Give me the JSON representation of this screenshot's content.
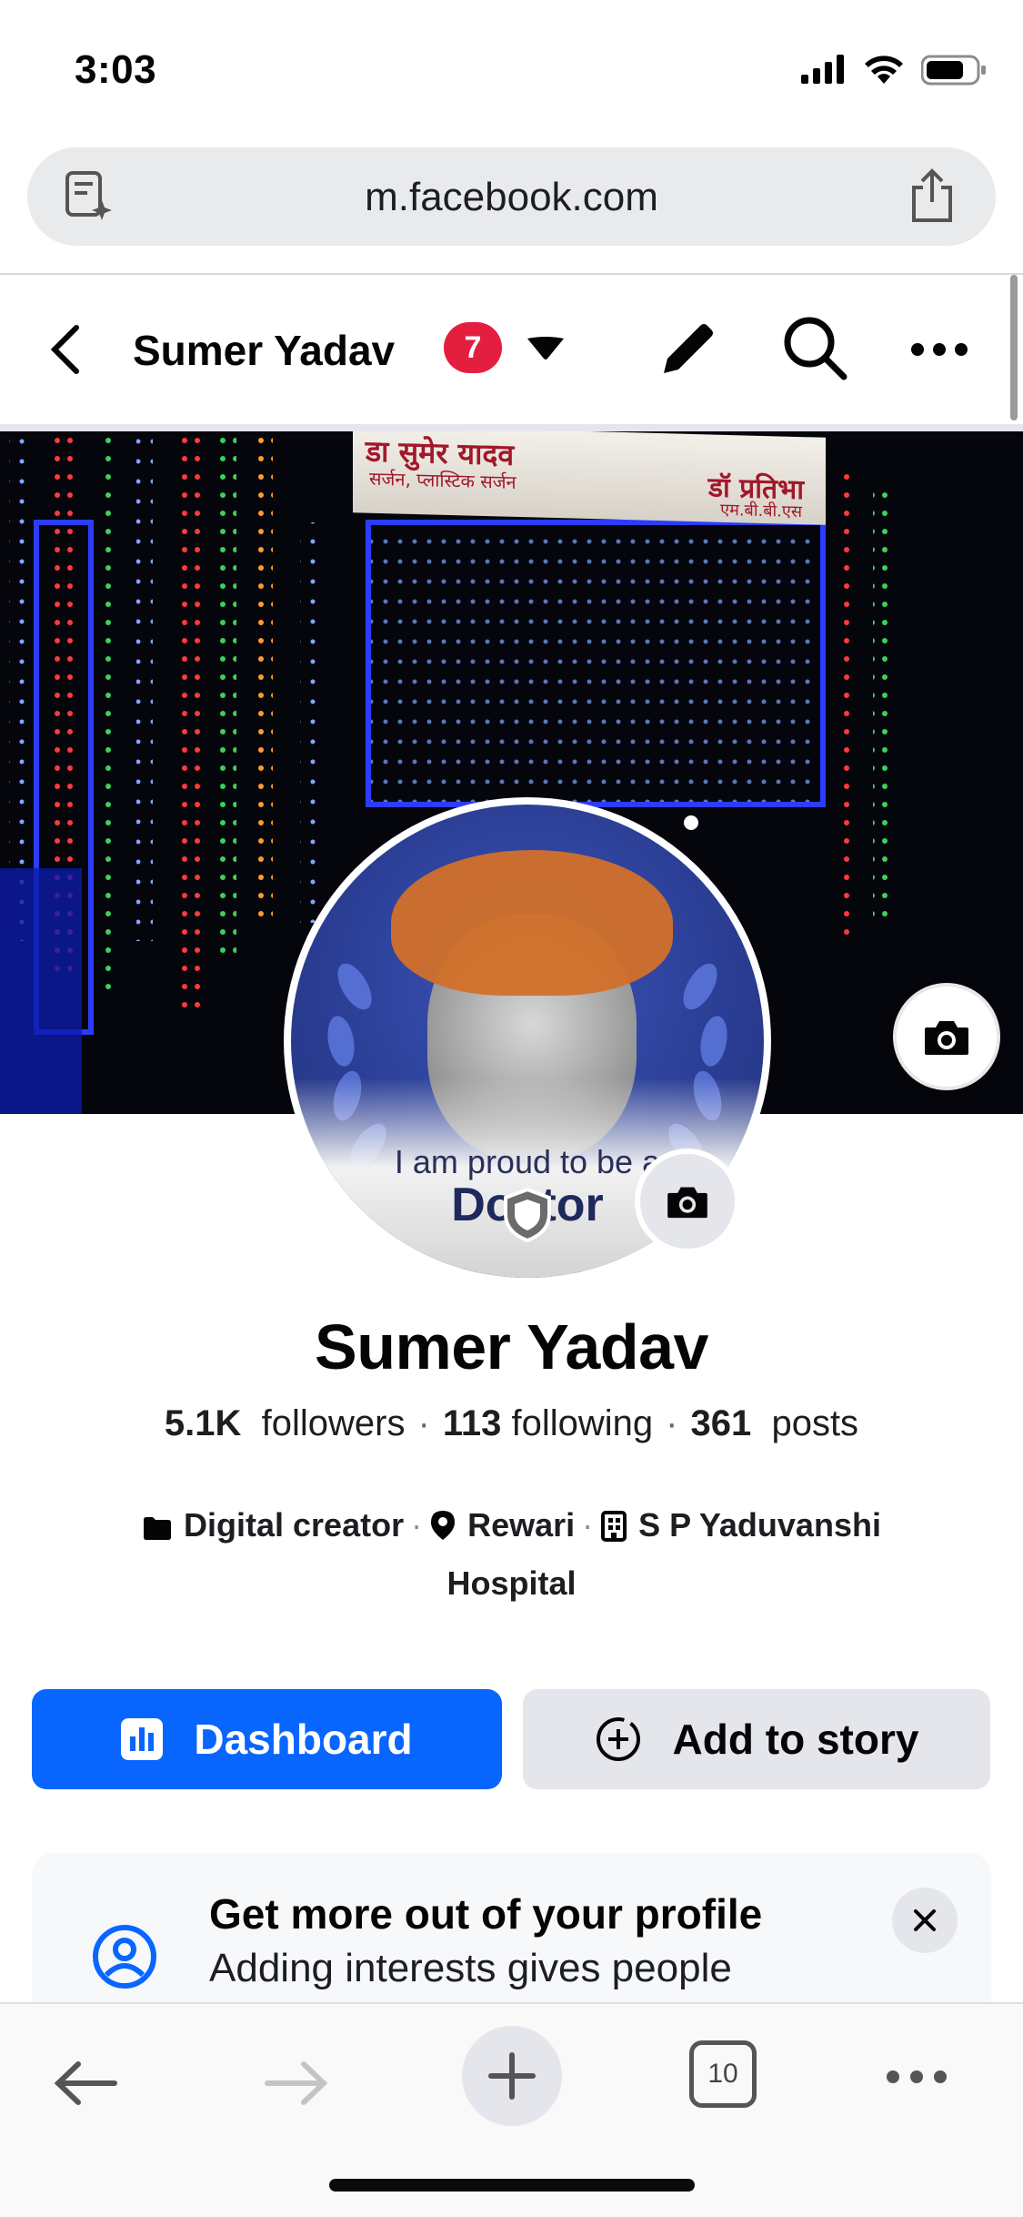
{
  "status_bar": {
    "time": "3:03"
  },
  "browser": {
    "url": "m.facebook.com",
    "tab_count": "10"
  },
  "header": {
    "title": "Sumer Yadav",
    "notification_count": "7"
  },
  "cover": {
    "sign_left_line1": "डा सुमेर यादव",
    "sign_left_line2": "सर्जन, प्लास्टिक सर्जन",
    "sign_right_line1": "डॉ प्रतिभा",
    "sign_right_line2": "एम.बी.बी.एस"
  },
  "avatar": {
    "frame_line1": "I am proud to be a",
    "frame_line2": "Doctor"
  },
  "profile": {
    "name": "Sumer Yadav",
    "followers_count": "5.1K",
    "followers_label": "followers",
    "following_count": "113",
    "following_label": "following",
    "posts_count": "361",
    "posts_label": "posts",
    "category": "Digital creator",
    "location": "Rewari",
    "workplace": "S P Yaduvanshi Hospital"
  },
  "actions": {
    "dashboard_label": "Dashboard",
    "add_story_label": "Add to story"
  },
  "card": {
    "title": "Get more out of your profile",
    "subtitle": "Adding interests gives people"
  },
  "colors": {
    "primary_blue": "#0866ff",
    "badge_red": "#e41e3f",
    "button_gray": "#e4e6eb"
  },
  "icons": {
    "reader": "reader-mode-icon",
    "share": "share-icon",
    "back": "chevron-left-icon",
    "caret": "caret-down-icon",
    "edit": "pencil-icon",
    "search": "search-icon",
    "more": "more-horizontal-icon",
    "camera": "camera-icon",
    "category": "briefcase-icon",
    "location": "pin-icon",
    "workplace": "building-icon",
    "dashboard": "bar-chart-icon",
    "add_story": "plus-circle-icon",
    "card": "profile-circle-icon",
    "close": "close-icon"
  }
}
